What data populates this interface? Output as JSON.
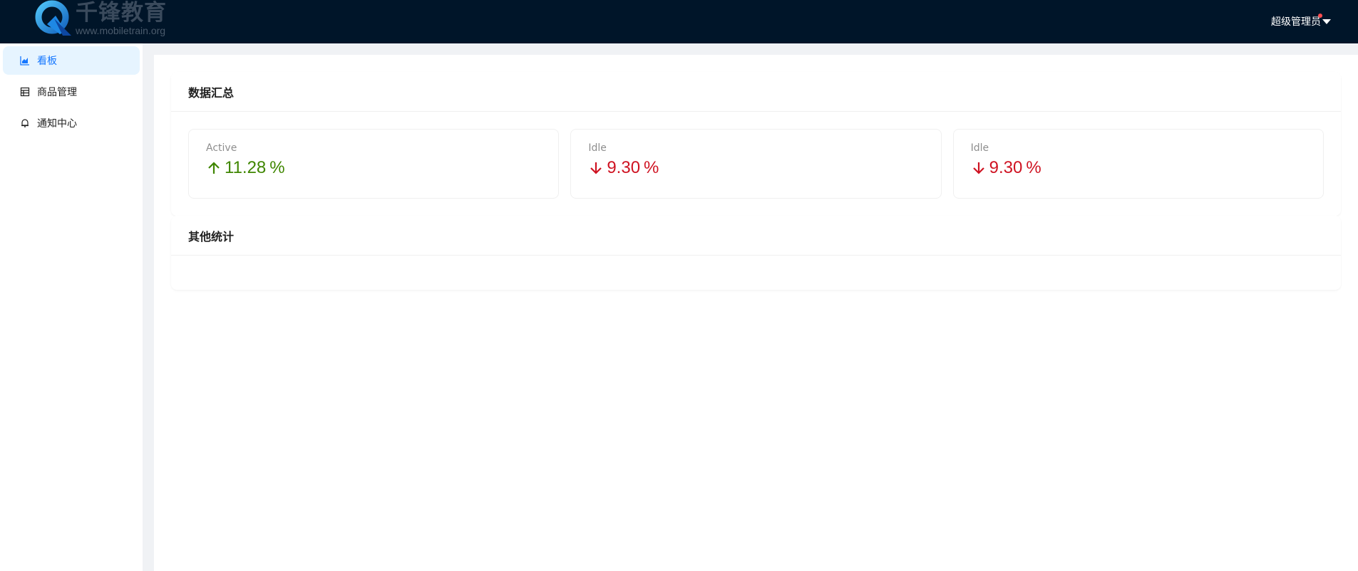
{
  "header": {
    "logo_title": "千锋教育",
    "logo_subtitle": "www.mobiletrain.org",
    "user_name": "超级管理员"
  },
  "sidebar": {
    "items": [
      {
        "label": "看板",
        "icon": "area-chart-icon",
        "active": true
      },
      {
        "label": "商品管理",
        "icon": "table-icon",
        "active": false
      },
      {
        "label": "通知中心",
        "icon": "bell-icon",
        "active": false
      }
    ]
  },
  "main": {
    "summary_title": "数据汇总",
    "stats": [
      {
        "title": "Active",
        "value": "11.28",
        "suffix": "%",
        "trend": "up",
        "color": "#3f8600"
      },
      {
        "title": "Idle",
        "value": "9.30",
        "suffix": "%",
        "trend": "down",
        "color": "#cf1322"
      },
      {
        "title": "Idle",
        "value": "9.30",
        "suffix": "%",
        "trend": "down",
        "color": "#cf1322"
      }
    ],
    "other_title": "其他统计"
  },
  "colors": {
    "header_bg": "#001529",
    "accent": "#1677ff",
    "active_bg": "#e6f4ff"
  }
}
